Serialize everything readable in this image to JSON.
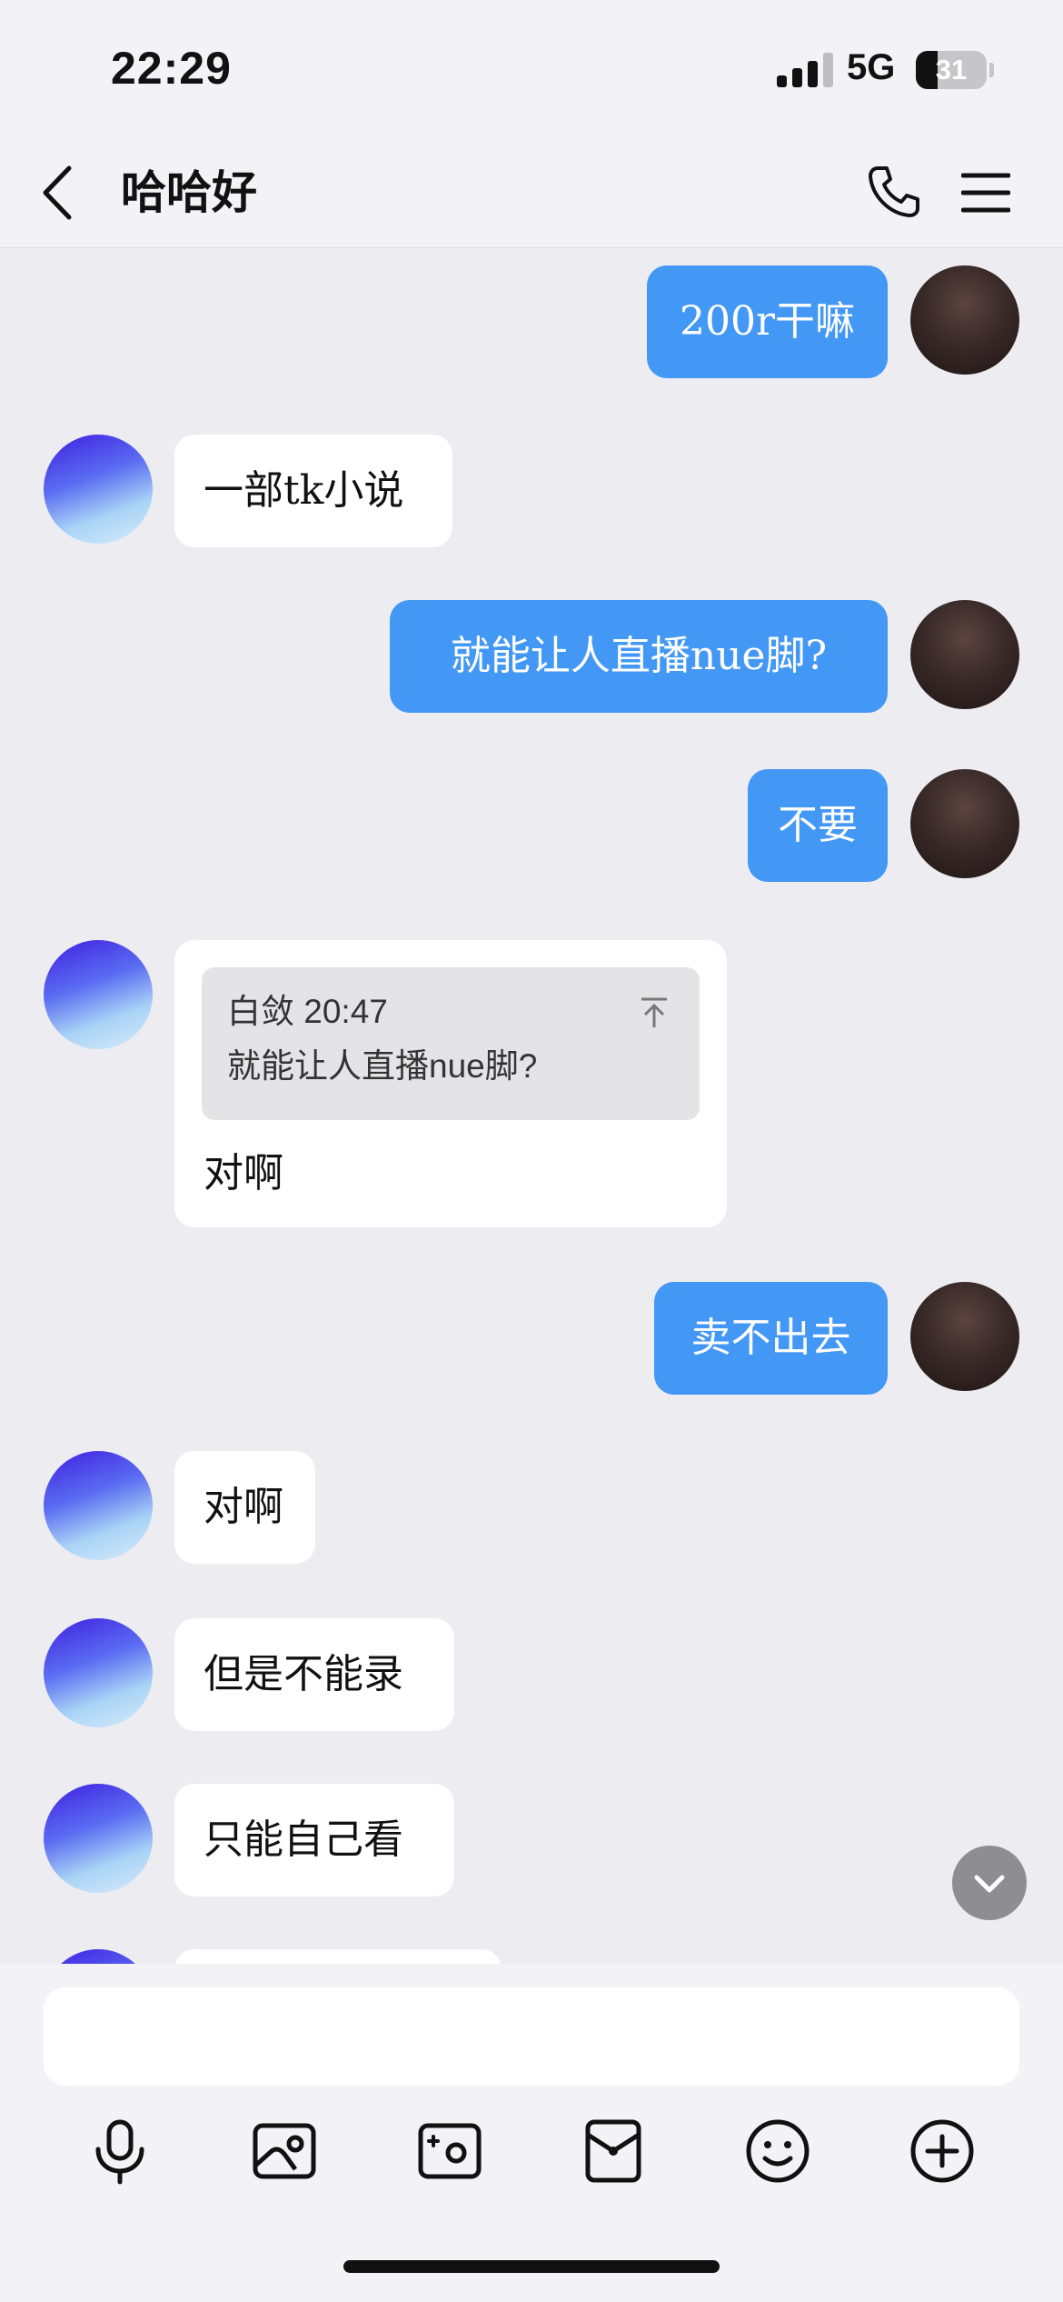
{
  "status_bar": {
    "time": "22:29",
    "network": "5G",
    "battery": "31",
    "battery_level": 0.31
  },
  "header": {
    "title": "哈哈好"
  },
  "messages": [
    {
      "side": "me",
      "text": "200r干嘛"
    },
    {
      "side": "other",
      "text": "一部tk小说"
    },
    {
      "side": "me",
      "text": "就能让人直播nue脚?"
    },
    {
      "side": "me",
      "text": "不要"
    },
    {
      "side": "other",
      "quote": {
        "meta": "白敛 20:47",
        "text": "就能让人直播nue脚?"
      },
      "text": "对啊"
    },
    {
      "side": "me",
      "text": "卖不出去"
    },
    {
      "side": "other",
      "text": "对啊"
    },
    {
      "side": "other",
      "text": "但是不能录"
    },
    {
      "side": "other",
      "text": "只能自己看"
    }
  ],
  "composer": {
    "placeholder": ""
  },
  "toolbar_icons": [
    "microphone-icon",
    "image-icon",
    "camera-icon",
    "red-packet-icon",
    "emoji-icon",
    "plus-icon"
  ],
  "colors": {
    "accent": "#4397f5",
    "background": "#ececf1",
    "bubble_other": "#ffffff"
  }
}
